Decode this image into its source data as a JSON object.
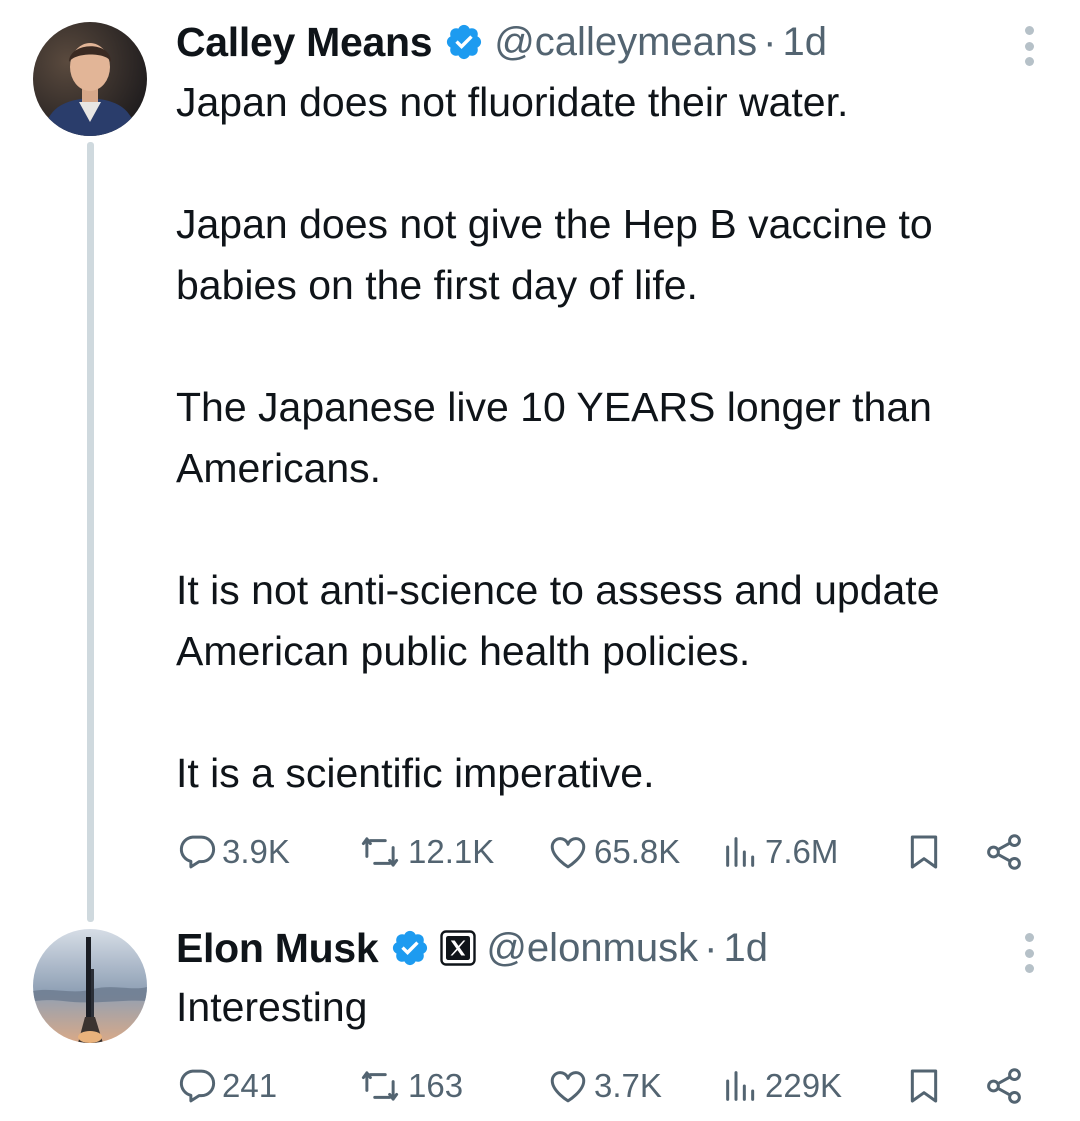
{
  "tweets": [
    {
      "name": "Calley Means",
      "handle": "@calleymeans",
      "separator": "·",
      "time": "1d",
      "text": "Japan does not fluoridate their water.\n\nJapan does not give the Hep B vaccine to babies on the first day of life.\n\nThe Japanese live 10 YEARS longer than Americans.\n\nIt is not anti-science to assess and update American public health policies.\n\nIt is a scientific imperative.",
      "replies": "3.9K",
      "reposts": "12.1K",
      "likes": "65.8K",
      "views": "7.6M"
    },
    {
      "name": "Elon Musk",
      "handle": "@elonmusk",
      "separator": "·",
      "time": "1d",
      "text": "Interesting",
      "replies": "241",
      "reposts": "163",
      "likes": "3.7K",
      "views": "229K"
    }
  ],
  "icons": {
    "verified": "verified-badge-icon",
    "affiliate": "x-affiliate-icon",
    "more": "more-options-icon",
    "reply": "reply-icon",
    "repost": "repost-icon",
    "like": "like-icon",
    "views": "views-icon",
    "bookmark": "bookmark-icon",
    "share": "share-icon"
  },
  "colors": {
    "text": "#0f1419",
    "secondary": "#536471",
    "verified": "#1d9bf0",
    "thread_line": "#cfd9de"
  }
}
